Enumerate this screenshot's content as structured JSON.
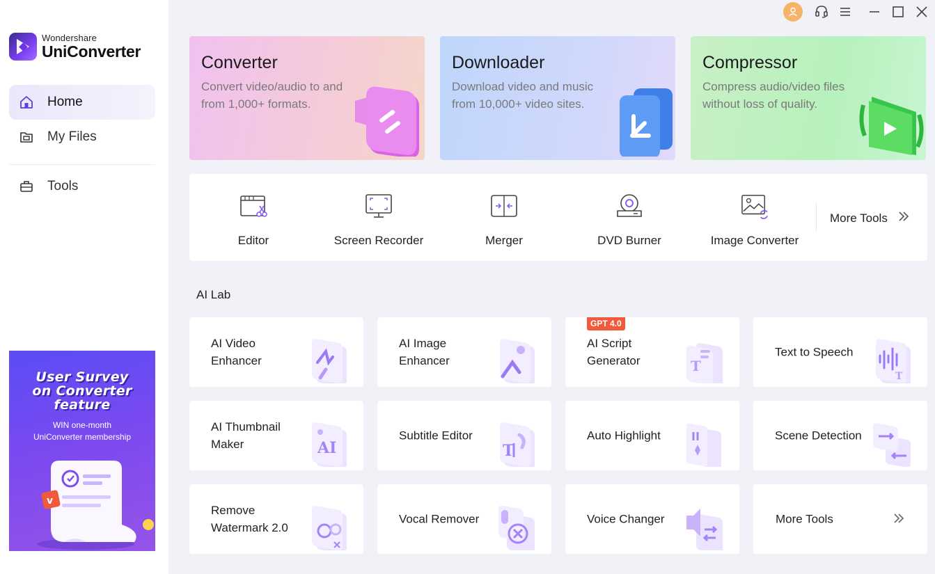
{
  "app": {
    "brand": "Wondershare",
    "product": "UniConverter"
  },
  "sidebar": {
    "items": [
      {
        "label": "Home",
        "icon": "home-icon",
        "active": true
      },
      {
        "label": "My Files",
        "icon": "folder-icon",
        "active": false
      },
      {
        "label": "Tools",
        "icon": "toolbox-icon",
        "active": false
      }
    ]
  },
  "promo": {
    "title_line1": "User Survey",
    "title_line2": "on Converter",
    "title_line3": "feature",
    "sub_line1": "WIN one-month",
    "sub_line2": "UniConverter membership"
  },
  "features": [
    {
      "title": "Converter",
      "desc": "Convert video/audio to and from 1,000+ formats."
    },
    {
      "title": "Downloader",
      "desc": "Download video and music from 10,000+ video sites."
    },
    {
      "title": "Compressor",
      "desc": "Compress audio/video files without loss of quality."
    }
  ],
  "tools": [
    {
      "label": "Editor",
      "icon": "editor-scissors-icon"
    },
    {
      "label": "Screen Recorder",
      "icon": "screen-recorder-icon"
    },
    {
      "label": "Merger",
      "icon": "merger-icon"
    },
    {
      "label": "DVD Burner",
      "icon": "dvd-burner-icon"
    },
    {
      "label": "Image Converter",
      "icon": "image-converter-icon"
    }
  ],
  "more_tools_label": "More Tools",
  "ailab": {
    "title": "AI Lab",
    "cards": [
      {
        "label": "AI Video Enhancer",
        "line1": "AI Video",
        "line2": "Enhancer"
      },
      {
        "label": "AI Image Enhancer",
        "line1": "AI Image",
        "line2": "Enhancer"
      },
      {
        "label": "AI Script Generator",
        "line1": "AI Script",
        "line2": "Generator",
        "badge": "GPT 4.0"
      },
      {
        "label": "Text to Speech",
        "line1": "Text to Speech",
        "line2": ""
      },
      {
        "label": "AI Thumbnail Maker",
        "line1": "AI Thumbnail",
        "line2": "Maker"
      },
      {
        "label": "Subtitle Editor",
        "line1": "Subtitle Editor",
        "line2": ""
      },
      {
        "label": "Auto Highlight",
        "line1": "Auto Highlight",
        "line2": ""
      },
      {
        "label": "Scene Detection",
        "line1": "Scene Detection",
        "line2": ""
      },
      {
        "label": "Remove Watermark 2.0",
        "line1": "Remove",
        "line2": "Watermark 2.0"
      },
      {
        "label": "Vocal Remover",
        "line1": "Vocal Remover",
        "line2": ""
      },
      {
        "label": "Voice Changer",
        "line1": "Voice Changer",
        "line2": ""
      },
      {
        "label": "More Tools",
        "line1": "More Tools",
        "line2": ""
      }
    ]
  },
  "colors": {
    "accent": "#7b4cf0",
    "sidebar_active": "#ebe7fb",
    "badge": "#f15a3a",
    "avatar": "#f7b469",
    "background": "#f0f2f8"
  }
}
